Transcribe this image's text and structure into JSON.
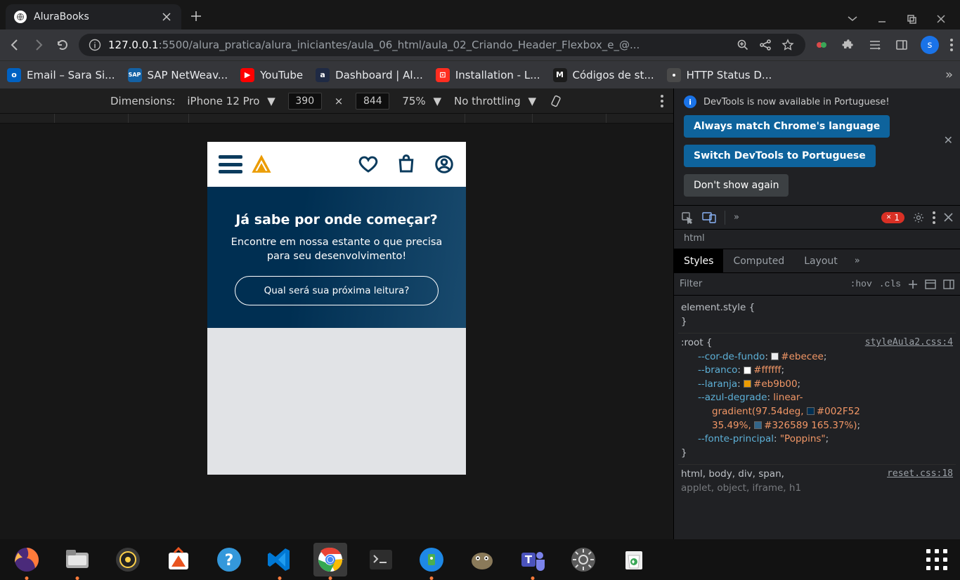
{
  "tab": {
    "title": "AluraBooks"
  },
  "omnibox": {
    "host": "127.0.0.1",
    "port_path": ":5500/alura_pratica/alura_iniciantes/aula_06_html/aula_02_Criando_Header_Flexbox_e_@..."
  },
  "bookmarks": [
    {
      "label": "Email – Sara Si...",
      "color": "#0061c2",
      "glyph": "o"
    },
    {
      "label": "SAP NetWeav...",
      "color": "#1461a4",
      "glyph": "SAP"
    },
    {
      "label": "YouTube",
      "color": "#ff0000",
      "glyph": "▶"
    },
    {
      "label": "Dashboard | Al...",
      "color": "#1f2a44",
      "glyph": "a"
    },
    {
      "label": "Installation - L...",
      "color": "#ff2d20",
      "glyph": "L"
    },
    {
      "label": "Códigos de st...",
      "color": "#1b1b1b",
      "glyph": "M"
    },
    {
      "label": "HTTP Status D...",
      "color": "#4a4a4a",
      "glyph": ""
    }
  ],
  "device_bar": {
    "label": "Dimensions:",
    "device": "iPhone 12 Pro",
    "width": "390",
    "height": "844",
    "zoom": "75%",
    "throttling": "No throttling"
  },
  "page": {
    "hero_title": "Já sabe por onde começar?",
    "hero_sub": "Encontre em nossa estante o que precisa para seu desenvolvimento!",
    "hero_placeholder": "Qual será sua próxima leitura?"
  },
  "devtools": {
    "banner_msg": "DevTools is now available in Portuguese!",
    "btn_always": "Always match Chrome's language",
    "btn_switch": "Switch DevTools to Portuguese",
    "btn_dont": "Don't show again",
    "error_count": "1",
    "crumb": "html",
    "tabs": {
      "styles": "Styles",
      "computed": "Computed",
      "layout": "Layout"
    },
    "filter_placeholder": "Filter",
    "hov": ":hov",
    "cls": ".cls",
    "rules": {
      "element_style": "element.style",
      "root_selector": ":root",
      "root_link": "styleAula2.css:4",
      "vars": [
        {
          "name": "--cor-de-fundo",
          "value": "#ebecee",
          "swatch": "#ebecee"
        },
        {
          "name": "--branco",
          "value": "#ffffff",
          "swatch": "#ffffff"
        },
        {
          "name": "--laranja",
          "value": "#eb9b00",
          "swatch": "#eb9b00"
        },
        {
          "name": "--azul-degrade",
          "value_pre": "linear-",
          "value_line2": "gradient(97.54deg, ",
          "sw1": "#002F52",
          "v1": "#002F52",
          "value_line3": "35.49%, ",
          "sw2": "#326589",
          "v2": "#326589 165.37%)"
        },
        {
          "name": "--fonte-principal",
          "value": "\"Poppins\""
        }
      ],
      "reset_selectors": "html, body, div, span,",
      "reset_line2": "applet, object, iframe, h1",
      "reset_link": "reset.css:18"
    }
  },
  "avatar_letter": "s"
}
